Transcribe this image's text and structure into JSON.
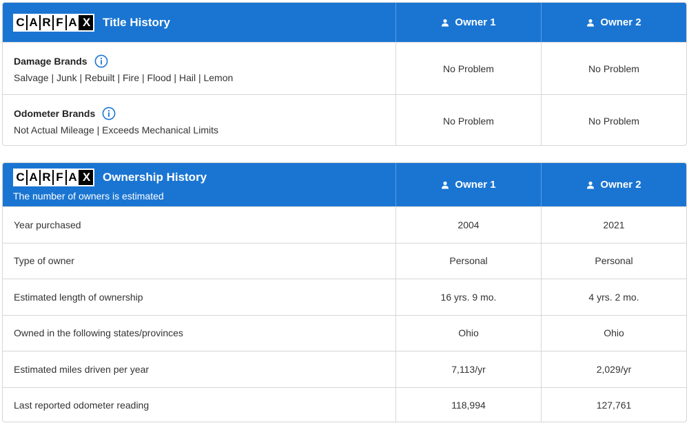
{
  "logo_letters": [
    "C",
    "A",
    "R",
    "F",
    "A",
    "X"
  ],
  "title_history": {
    "title": "Title History",
    "owner1": "Owner 1",
    "owner2": "Owner 2",
    "rows": [
      {
        "label": "Damage Brands",
        "detail": "Salvage | Junk | Rebuilt | Fire | Flood | Hail | Lemon",
        "owner1": "No Problem",
        "owner2": "No Problem"
      },
      {
        "label": "Odometer Brands",
        "detail": "Not Actual Mileage | Exceeds Mechanical Limits",
        "owner1": "No Problem",
        "owner2": "No Problem"
      }
    ]
  },
  "ownership_history": {
    "title": "Ownership History",
    "subtitle": "The number of owners is estimated",
    "owner1": "Owner 1",
    "owner2": "Owner 2",
    "rows": [
      {
        "label": "Year purchased",
        "owner1": "2004",
        "owner2": "2021"
      },
      {
        "label": "Type of owner",
        "owner1": "Personal",
        "owner2": "Personal"
      },
      {
        "label": "Estimated length of ownership",
        "owner1": "16 yrs. 9 mo.",
        "owner2": "4 yrs. 2 mo."
      },
      {
        "label": "Owned in the following states/provinces",
        "owner1": "Ohio",
        "owner2": "Ohio"
      },
      {
        "label": "Estimated miles driven per year",
        "owner1": "7,113/yr",
        "owner2": "2,029/yr"
      },
      {
        "label": "Last reported odometer reading",
        "owner1": "118,994",
        "owner2": "127,761"
      }
    ]
  },
  "colors": {
    "header_blue": "#1a75d2",
    "info_blue": "#1a75d2"
  },
  "icons": {
    "owner": "person-icon",
    "info": "info-icon"
  }
}
